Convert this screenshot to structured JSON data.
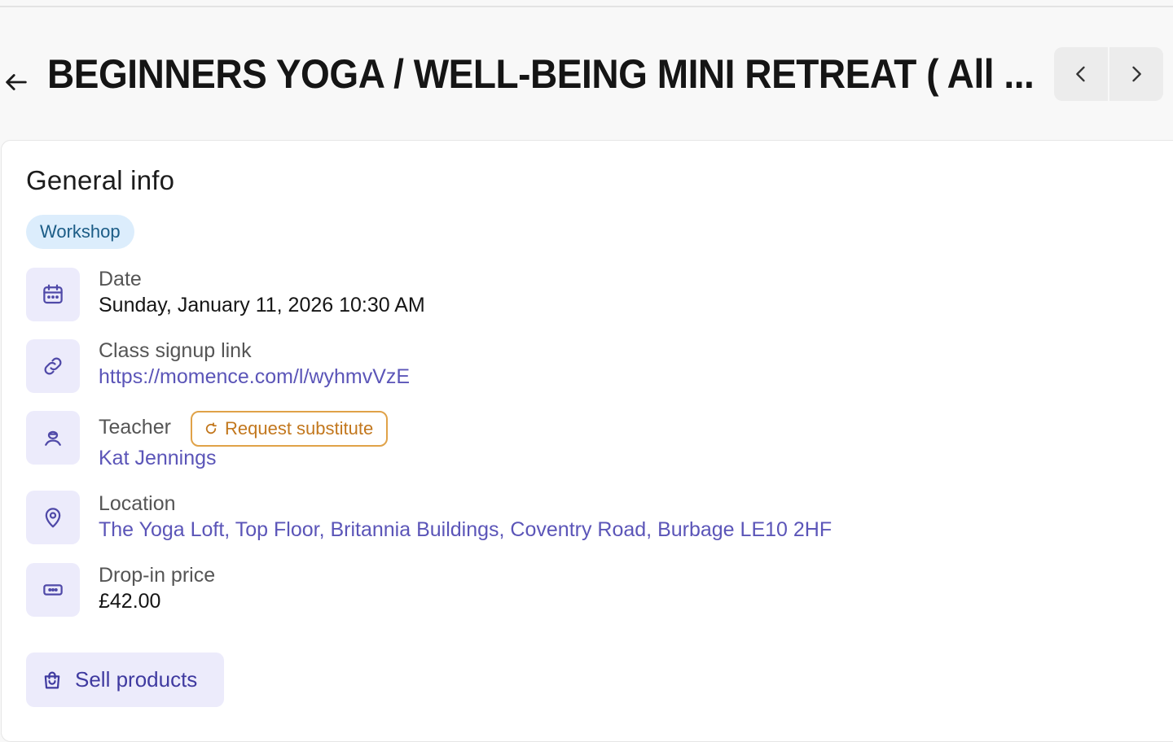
{
  "header": {
    "title": "BEGINNERS YOGA / WELL-BEING MINI RETREAT ( All ...",
    "back_icon": "arrow-left-icon",
    "prev_icon": "chevron-left-icon",
    "next_icon": "chevron-right-icon"
  },
  "general_info": {
    "title": "General info",
    "tag": "Workshop",
    "rows": {
      "date": {
        "label": "Date",
        "value": "Sunday, January 11, 2026 10:30 AM",
        "icon": "calendar-icon"
      },
      "signup": {
        "label": "Class signup link",
        "value": "https://momence.com/l/wyhmvVzE",
        "icon": "link-icon"
      },
      "teacher": {
        "label": "Teacher",
        "value": "Kat Jennings",
        "icon": "person-icon",
        "action": "Request substitute",
        "action_icon": "refresh-icon"
      },
      "location": {
        "label": "Location",
        "value": "The Yoga Loft, Top Floor, Britannia Buildings, Coventry Road, Burbage LE10 2HF",
        "icon": "map-pin-icon"
      },
      "price": {
        "label": "Drop-in price",
        "value": "£42.00",
        "icon": "ticket-icon"
      }
    },
    "sell_button": {
      "label": "Sell products",
      "icon": "shopping-bag-icon"
    }
  },
  "colors": {
    "accent": "#5b55b8",
    "icon_bg": "#ecebfb",
    "tag_bg": "#dcedfc",
    "warning": "#e0a248"
  }
}
